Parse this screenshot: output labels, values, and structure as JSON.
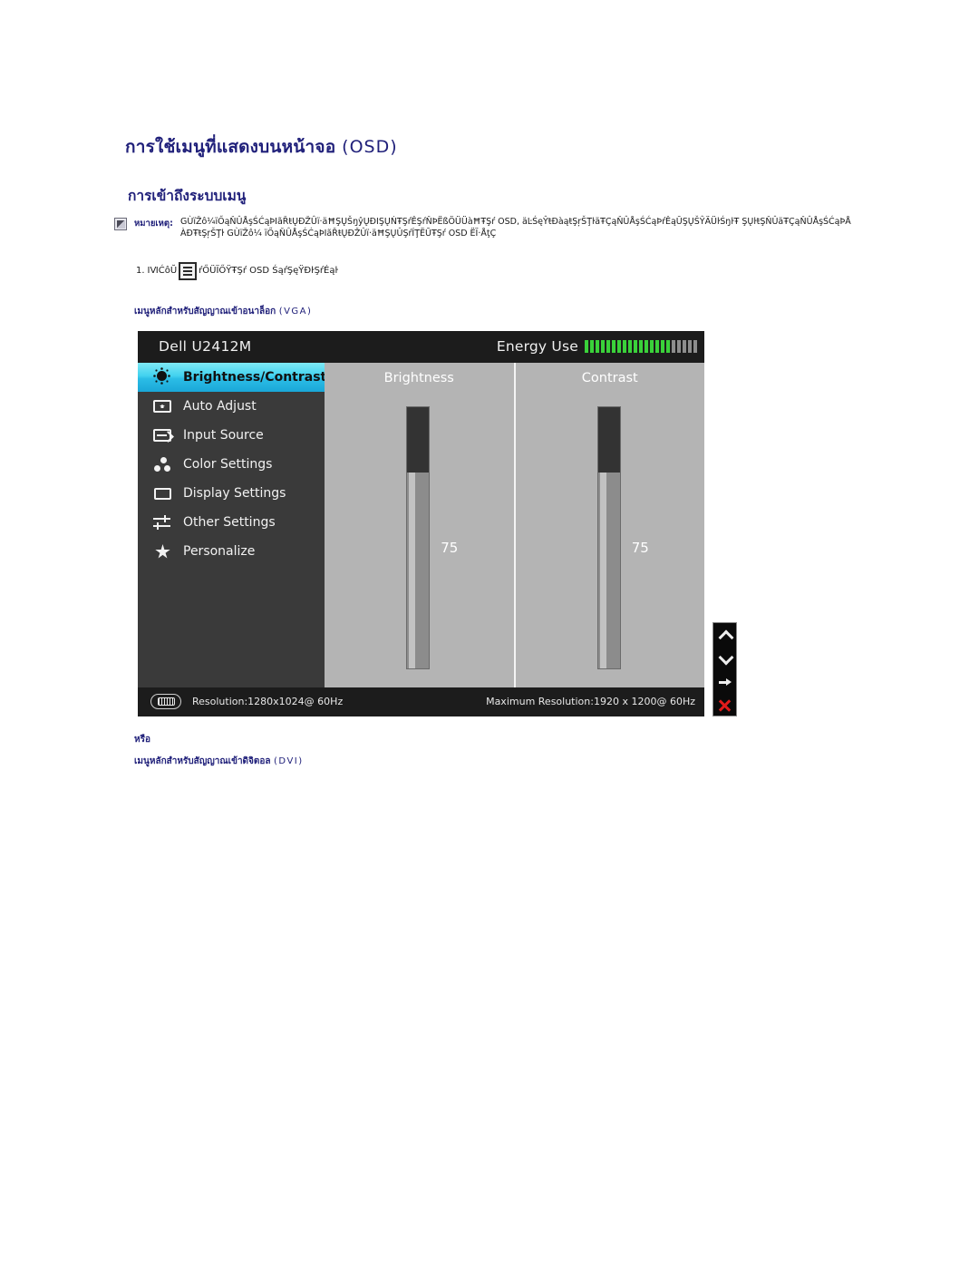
{
  "document": {
    "title_thai": "การใช้เมนูที่แสดงบนหน้าจอ",
    "title_latin": "(OSD)",
    "section_heading": "การเข้าถึงระบบเมนู",
    "note_label": "หมายเหตุ:",
    "note_body": "GÙïŽô¼ïŐąŇÛÅşŚĆąÞIãŘŧŲÐŽÛï·äĦŞŲŠŋŷŲÐIŞŲŃŦŞŕÊŞŕŇÞËßÖÜÜàĦŦŞŕ OSD, äĿŚęŶŧÐàąŧŞŗŠŢŀäŦÇąŇÛÅşŚĆąÞŕÊąŪŞŲŠŶÄÜŀŚŋŀŦ ŞŲŀŧŞŇÛäŦÇąŇÛÅşŚĆąÞÅÀÐŦŧŞŗŠŢŀ GÙïŽô¼ ïŐąŇÛÅşŚĆąÞIãŘŧŲÐŽÛï·äĦŞŲÛŞŕÍŢËŪŦŞŕ OSD ËÏ·ÅţÇ",
    "step_number": "1.",
    "step_prefix": "ΙⅥĆôŬ",
    "step_suffix": "ŕŐÜÏŐŸŦŞŕ OSD ŚąŕŞęŸÐŀŞŕÉąŀ",
    "step_icon": "menu-button-icon",
    "caption_vga_thai": "เมนูหลักสำหรับสัญญาณเข้าอนาล็อก",
    "caption_vga_latin": "(VGA)",
    "caption_or": "หรือ",
    "caption_dvi_thai": "เมนูหลักสำหรับสัญญาณเข้าดิจิตอล",
    "caption_dvi_latin": "(DVI)"
  },
  "osd": {
    "monitor_model": "Dell U2412M",
    "energy": {
      "label": "Energy Use",
      "bars_total": 21,
      "bars_on": 16
    },
    "menu_items": [
      {
        "label": "Brightness/Contrast",
        "icon": "brightness-sun-icon",
        "selected": true
      },
      {
        "label": "Auto Adjust",
        "icon": "auto-adjust-icon",
        "selected": false
      },
      {
        "label": "Input Source",
        "icon": "input-source-icon",
        "selected": false
      },
      {
        "label": "Color Settings",
        "icon": "color-dots-icon",
        "selected": false
      },
      {
        "label": "Display Settings",
        "icon": "display-screen-icon",
        "selected": false
      },
      {
        "label": "Other Settings",
        "icon": "sliders-icon",
        "selected": false
      },
      {
        "label": "Personalize",
        "icon": "star-icon",
        "selected": false
      }
    ],
    "panels": [
      {
        "title": "Brightness",
        "value": "75",
        "percent": 75
      },
      {
        "title": "Contrast",
        "value": "75",
        "percent": 75
      }
    ],
    "footer": {
      "connector_icon": "vga-connector-icon",
      "resolution": "Resolution:1280x1024@ 60Hz",
      "maximum_resolution": "Maximum Resolution:1920 x 1200@ 60Hz"
    },
    "controls": [
      {
        "name": "up-chevron-icon",
        "glyph": "up"
      },
      {
        "name": "down-chevron-icon",
        "glyph": "down"
      },
      {
        "name": "right-arrow-icon",
        "glyph": "right"
      },
      {
        "name": "close-x-icon",
        "glyph": "close"
      }
    ]
  },
  "colors": {
    "heading": "#20207a",
    "osd_background": "#1c1c1c",
    "sidebar": "#3a3a3a",
    "panel": "#b4b4b4",
    "highlight_cyan": "#42d2ef",
    "energy_green": "#3ad13a",
    "close_red": "#e01b1b"
  }
}
